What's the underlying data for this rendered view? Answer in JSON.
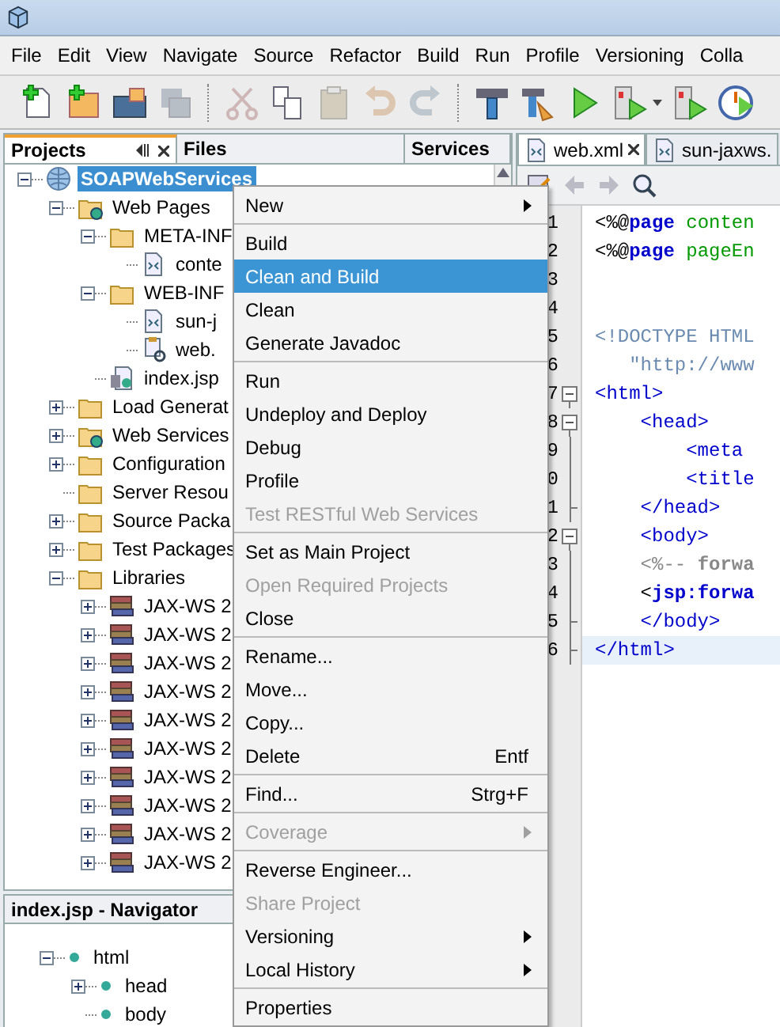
{
  "menubar": [
    {
      "label": "File"
    },
    {
      "label": "Edit"
    },
    {
      "label": "View"
    },
    {
      "label": "Navigate"
    },
    {
      "label": "Source"
    },
    {
      "label": "Refactor"
    },
    {
      "label": "Build"
    },
    {
      "label": "Run"
    },
    {
      "label": "Profile"
    },
    {
      "label": "Versioning"
    },
    {
      "label": "Colla"
    }
  ],
  "toolbar": [
    {
      "kind": "new-file",
      "disabled": false
    },
    {
      "kind": "new-project",
      "disabled": false
    },
    {
      "kind": "open-project",
      "disabled": false
    },
    {
      "kind": "save-all",
      "disabled": true
    },
    {
      "kind": "sep"
    },
    {
      "kind": "cut",
      "disabled": true
    },
    {
      "kind": "copy",
      "disabled": false
    },
    {
      "kind": "paste",
      "disabled": true
    },
    {
      "kind": "undo",
      "disabled": true
    },
    {
      "kind": "redo",
      "disabled": true
    },
    {
      "kind": "sep"
    },
    {
      "kind": "build",
      "disabled": false
    },
    {
      "kind": "clean-build",
      "disabled": false
    },
    {
      "kind": "run",
      "disabled": false
    },
    {
      "kind": "debug",
      "disabled": false
    },
    {
      "kind": "dropdown",
      "disabled": false
    },
    {
      "kind": "debug",
      "disabled": false
    },
    {
      "kind": "profile",
      "disabled": false
    }
  ],
  "projects_panel": {
    "tabs": [
      {
        "label": "Projects",
        "selected": true
      },
      {
        "label": "Files",
        "selected": false
      },
      {
        "label": "Services",
        "selected": false
      }
    ],
    "tree": [
      {
        "label": "SOAPWebServices",
        "kind": "project",
        "selected": true,
        "expanded": true,
        "children": [
          {
            "label": "Web Pages",
            "kind": "webfolder",
            "selected": false,
            "expanded": true,
            "children": [
              {
                "label": "META-INF",
                "kind": "folder",
                "selected": false,
                "expanded": true,
                "children": [
                  {
                    "label": "conte",
                    "kind": "xmlfile",
                    "selected": false
                  }
                ]
              },
              {
                "label": "WEB-INF",
                "kind": "folder",
                "selected": false,
                "expanded": true,
                "children": [
                  {
                    "label": "sun-j",
                    "kind": "xmlfile",
                    "selected": false
                  },
                  {
                    "label": "web.",
                    "kind": "configfile",
                    "selected": false
                  }
                ]
              },
              {
                "label": "index.jsp",
                "kind": "jspfile",
                "selected": false
              }
            ]
          },
          {
            "label": "Load Generat",
            "kind": "folder",
            "selected": false,
            "expanded": false
          },
          {
            "label": "Web Services",
            "kind": "webfolder",
            "selected": false,
            "expanded": false
          },
          {
            "label": "Configuration",
            "kind": "folder",
            "selected": false,
            "expanded": false
          },
          {
            "label": "Server Resou",
            "kind": "folder",
            "selected": false
          },
          {
            "label": "Source Packa",
            "kind": "folder",
            "selected": false,
            "expanded": false
          },
          {
            "label": "Test Packages",
            "kind": "folder",
            "selected": false,
            "expanded": false
          },
          {
            "label": "Libraries",
            "kind": "folder",
            "selected": false,
            "expanded": true,
            "children": [
              {
                "label": "JAX-WS 2",
                "kind": "library",
                "selected": false,
                "expanded": false
              },
              {
                "label": "JAX-WS 2",
                "kind": "library",
                "selected": false,
                "expanded": false
              },
              {
                "label": "JAX-WS 2",
                "kind": "library",
                "selected": false,
                "expanded": false
              },
              {
                "label": "JAX-WS 2",
                "kind": "library",
                "selected": false,
                "expanded": false
              },
              {
                "label": "JAX-WS 2",
                "kind": "library",
                "selected": false,
                "expanded": false
              },
              {
                "label": "JAX-WS 2",
                "kind": "library",
                "selected": false,
                "expanded": false
              },
              {
                "label": "JAX-WS 2",
                "kind": "library",
                "selected": false,
                "expanded": false
              },
              {
                "label": "JAX-WS 2",
                "kind": "library",
                "selected": false,
                "expanded": false
              },
              {
                "label": "JAX-WS 2",
                "kind": "library",
                "selected": false,
                "expanded": false
              },
              {
                "label": "JAX-WS 2",
                "kind": "library",
                "selected": false,
                "expanded": false
              }
            ]
          }
        ]
      }
    ]
  },
  "navigator": {
    "title": "index.jsp - Navigator",
    "tree": [
      {
        "label": "html",
        "kind": "element",
        "selected": false,
        "expanded": true,
        "children": [
          {
            "label": "head",
            "kind": "element",
            "selected": false,
            "expanded": false
          },
          {
            "label": "body",
            "kind": "element",
            "selected": false
          }
        ]
      }
    ]
  },
  "editor": {
    "tabs": [
      {
        "label": "web.xml",
        "selected": true
      },
      {
        "label": "sun-jaxws.",
        "selected": false
      }
    ],
    "lines": [
      {
        "num": "1",
        "current": false,
        "tokens": [
          {
            "t": "<%@",
            "kind": "delim"
          },
          {
            "t": "page",
            "kind": "keyword"
          },
          {
            "t": " conten",
            "kind": "attr"
          }
        ]
      },
      {
        "num": "2",
        "current": false,
        "tokens": [
          {
            "t": "<%@",
            "kind": "delim"
          },
          {
            "t": "page",
            "kind": "keyword"
          },
          {
            "t": " pageEn",
            "kind": "attr"
          }
        ]
      },
      {
        "num": "3",
        "current": false
      },
      {
        "num": "4",
        "current": false
      },
      {
        "num": "5",
        "current": false,
        "tokens": [
          {
            "t": "<!DOCTYPE HTML",
            "kind": "doctype"
          }
        ]
      },
      {
        "num": "6",
        "current": false,
        "tokens": [
          {
            "t": "   \"http://www",
            "kind": "doctype"
          }
        ]
      },
      {
        "num": "7",
        "current": false,
        "fold": {
          "kind": "start"
        },
        "tokens": [
          {
            "t": "<html>",
            "kind": "tag"
          }
        ]
      },
      {
        "num": "8",
        "current": false,
        "fold": {
          "kind": "start"
        },
        "tokens": [
          {
            "t": "    <head>",
            "kind": "tag"
          }
        ]
      },
      {
        "num": "9",
        "current": false,
        "fold": {
          "kind": "line"
        },
        "tokens": [
          {
            "t": "        <meta",
            "kind": "tag"
          }
        ]
      },
      {
        "num": "0",
        "current": false,
        "fold": {
          "kind": "line"
        },
        "tokens": [
          {
            "t": "        <title",
            "kind": "tag"
          }
        ]
      },
      {
        "num": "1",
        "current": false,
        "fold": {
          "kind": "end"
        },
        "tokens": [
          {
            "t": "    </head>",
            "kind": "tag"
          }
        ]
      },
      {
        "num": "2",
        "current": false,
        "fold": {
          "kind": "start"
        },
        "tokens": [
          {
            "t": "    <body>",
            "kind": "tag"
          }
        ]
      },
      {
        "num": "3",
        "current": false,
        "fold": {
          "kind": "line"
        },
        "tokens": [
          {
            "t": "    <%-- ",
            "kind": "comment"
          },
          {
            "t": "forwa",
            "kind": "commentbold"
          }
        ]
      },
      {
        "num": "4",
        "current": false,
        "fold": {
          "kind": "line"
        },
        "tokens": [
          {
            "t": "    <",
            "kind": "delim"
          },
          {
            "t": "jsp:forwa",
            "kind": "keyword"
          }
        ]
      },
      {
        "num": "5",
        "current": false,
        "fold": {
          "kind": "end"
        },
        "tokens": [
          {
            "t": "    </body>",
            "kind": "tag"
          }
        ]
      },
      {
        "num": "6",
        "current": true,
        "fold": {
          "kind": "end"
        },
        "tokens": [
          {
            "t": "</html>",
            "kind": "tag"
          }
        ]
      }
    ]
  },
  "context_menu": [
    {
      "kind": "item",
      "label": "New",
      "submenu": true,
      "disabled": false,
      "selected": false
    },
    {
      "kind": "separator"
    },
    {
      "kind": "item",
      "label": "Build",
      "disabled": false,
      "selected": false
    },
    {
      "kind": "item",
      "label": "Clean and Build",
      "disabled": false,
      "selected": true
    },
    {
      "kind": "item",
      "label": "Clean",
      "disabled": false,
      "selected": false
    },
    {
      "kind": "item",
      "label": "Generate Javadoc",
      "disabled": false,
      "selected": false
    },
    {
      "kind": "separator"
    },
    {
      "kind": "item",
      "label": "Run",
      "disabled": false,
      "selected": false
    },
    {
      "kind": "item",
      "label": "Undeploy and Deploy",
      "disabled": false,
      "selected": false
    },
    {
      "kind": "item",
      "label": "Debug",
      "disabled": false,
      "selected": false
    },
    {
      "kind": "item",
      "label": "Profile",
      "disabled": false,
      "selected": false
    },
    {
      "kind": "item",
      "label": "Test RESTful Web Services",
      "disabled": true,
      "selected": false
    },
    {
      "kind": "separator"
    },
    {
      "kind": "item",
      "label": "Set as Main Project",
      "disabled": false,
      "selected": false
    },
    {
      "kind": "item",
      "label": "Open Required Projects",
      "disabled": true,
      "selected": false
    },
    {
      "kind": "item",
      "label": "Close",
      "disabled": false,
      "selected": false
    },
    {
      "kind": "separator"
    },
    {
      "kind": "item",
      "label": "Rename...",
      "disabled": false,
      "selected": false
    },
    {
      "kind": "item",
      "label": "Move...",
      "disabled": false,
      "selected": false
    },
    {
      "kind": "item",
      "label": "Copy...",
      "disabled": false,
      "selected": false
    },
    {
      "kind": "item",
      "label": "Delete",
      "shortcut": "Entf",
      "disabled": false,
      "selected": false
    },
    {
      "kind": "separator"
    },
    {
      "kind": "item",
      "label": "Find...",
      "shortcut": "Strg+F",
      "disabled": false,
      "selected": false
    },
    {
      "kind": "separator"
    },
    {
      "kind": "item",
      "label": "Coverage",
      "submenu": true,
      "disabled": true,
      "selected": false
    },
    {
      "kind": "separator"
    },
    {
      "kind": "item",
      "label": "Reverse Engineer...",
      "disabled": false,
      "selected": false
    },
    {
      "kind": "item",
      "label": "Share Project",
      "disabled": true,
      "selected": false
    },
    {
      "kind": "item",
      "label": "Versioning",
      "submenu": true,
      "disabled": false,
      "selected": false
    },
    {
      "kind": "item",
      "label": "Local History",
      "submenu": true,
      "disabled": false,
      "selected": false
    },
    {
      "kind": "separator"
    },
    {
      "kind": "item",
      "label": "Properties",
      "disabled": false,
      "selected": false
    }
  ]
}
